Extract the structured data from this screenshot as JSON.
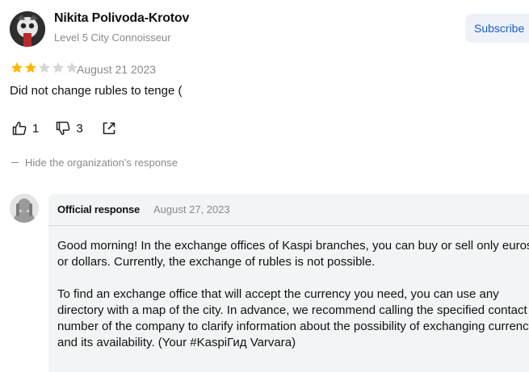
{
  "review": {
    "author_name": "Nikita Polivoda-Krotov",
    "author_level": "Level 5 City Connoisseur",
    "subscribe_label": "Subscribe",
    "rating": 2,
    "rating_max": 5,
    "date": "August 21 2023",
    "text": "Did not change rubles to tenge (",
    "likes": "1",
    "dislikes": "3",
    "hide_response_label": "Hide the organization's response"
  },
  "response": {
    "label": "Official response",
    "date": "August 27, 2023",
    "paragraphs": [
      "Good morning! In the exchange offices of Kaspi branches, you can buy or sell only euros or dollars. Currently, the exchange of rubles is not possible.",
      "To find an exchange office that will accept the currency you need, you can use any directory with a map of the city. In advance, we recommend calling the specified contact number of the company to clarify information about the possibility of exchanging currency and its availability. (Your #KaspiГид Varvara)"
    ]
  },
  "colors": {
    "star_filled": "#fcb800",
    "star_empty": "#d6d6d6",
    "link": "#1a5ccf",
    "muted": "#8a8a8a",
    "response_bg": "#f3f4f5"
  },
  "icons": [
    "thumbs-up-icon",
    "thumbs-down-icon",
    "share-icon",
    "star-icon"
  ]
}
